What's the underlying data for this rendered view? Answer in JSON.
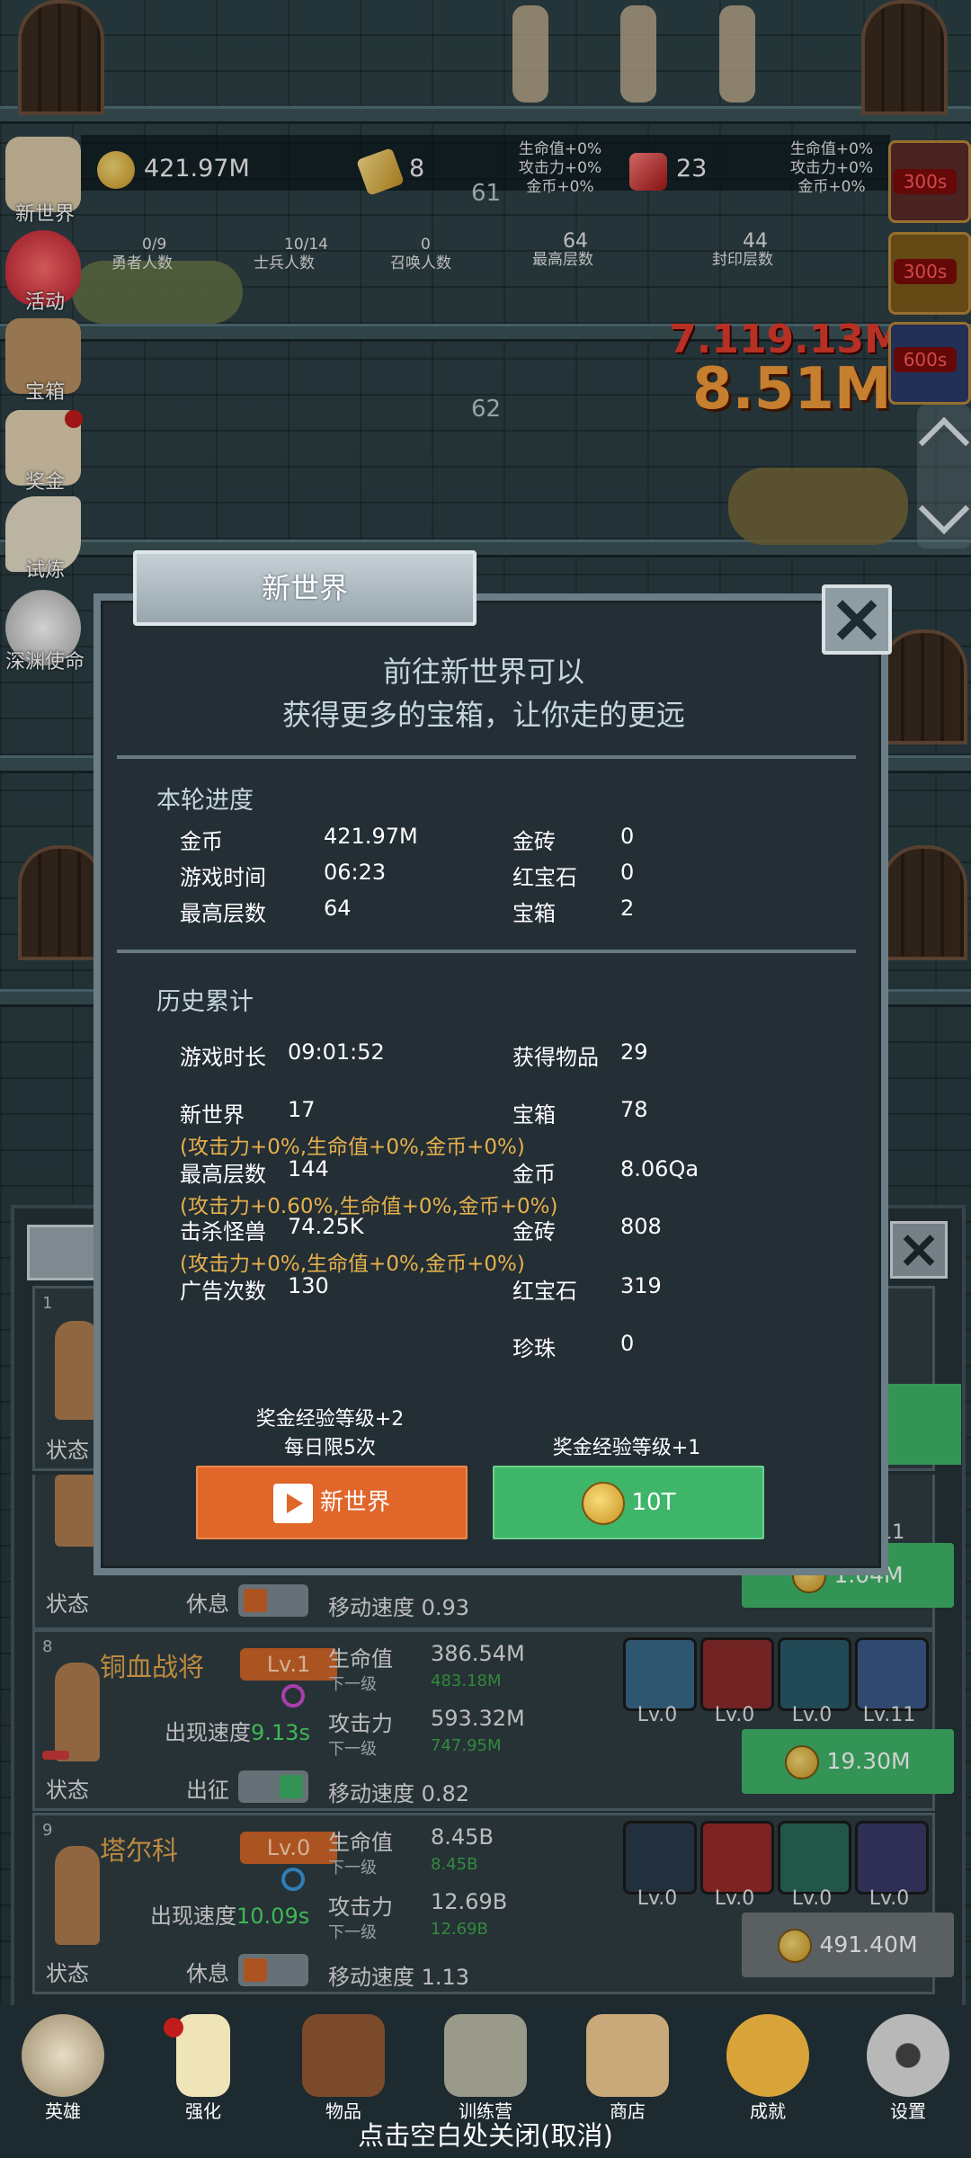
{
  "hud": {
    "gold": "421.97M",
    "gold_bar": "8",
    "ruby": "23",
    "bonus_left": [
      "生命值+0%",
      "攻击力+0%",
      "金币+0%"
    ],
    "bonus_right": [
      "生命值+0%",
      "攻击力+0%",
      "金币+0%"
    ],
    "floor_top": "61",
    "floor_mid": "62",
    "stats": [
      {
        "value": "0/9",
        "label": "勇者人数"
      },
      {
        "value": "10/14",
        "label": "士兵人数"
      },
      {
        "value": "0",
        "label": "召唤人数"
      },
      {
        "value": "64",
        "label": "最高层数"
      },
      {
        "value": "44",
        "label": "封印层数"
      }
    ],
    "damage_1": "7.119.13M",
    "damage_2": "8.51M",
    "timers": [
      "300s",
      "300s",
      "600s"
    ]
  },
  "side_menu": [
    {
      "label": "新世界",
      "icon": "scroll-icon"
    },
    {
      "label": "活动",
      "icon": "heart-icon"
    },
    {
      "label": "宝箱",
      "icon": "chest-icon"
    },
    {
      "label": "奖金",
      "icon": "envelope-icon"
    },
    {
      "label": "试炼",
      "icon": "horn-icon"
    },
    {
      "label": "深渊使命",
      "icon": "orb-icon"
    }
  ],
  "modal": {
    "title": "新世界",
    "intro_1": "前往新世界可以",
    "intro_2": "获得更多的宝箱，让你走的更远",
    "round_title": "本轮进度",
    "round": {
      "gold_label": "金币",
      "gold": "421.97M",
      "bar_label": "金砖",
      "bar": "0",
      "time_label": "游戏时间",
      "time": "06:23",
      "ruby_label": "红宝石",
      "ruby": "0",
      "floor_label": "最高层数",
      "floor": "64",
      "chest_label": "宝箱",
      "chest": "2"
    },
    "history_title": "历史累计",
    "history": {
      "playtime_label": "游戏时长",
      "playtime": "09:01:52",
      "items_label": "获得物品",
      "items": "29",
      "newworld_label": "新世界",
      "newworld": "17",
      "chest_label": "宝箱",
      "chest": "78",
      "bonus_1": "(攻击力+0%,生命值+0%,金币+0%)",
      "floor_label": "最高层数",
      "floor": "144",
      "gold_label": "金币",
      "gold": "8.06Qa",
      "bonus_2": "(攻击力+0.60%,生命值+0%,金币+0%)",
      "kills_label": "击杀怪兽",
      "kills": "74.25K",
      "bar_label": "金砖",
      "bar": "808",
      "bonus_3": "(攻击力+0%,生命值+0%,金币+0%)",
      "ads_label": "广告次数",
      "ads": "130",
      "ruby_label": "红宝石",
      "ruby": "319",
      "pearl_label": "珍珠",
      "pearl": "0"
    },
    "note_left_1": "奖金经验等级+2",
    "note_left_2": "每日限5次",
    "note_right": "奖金经验等级+1",
    "btn_video": "新世界",
    "btn_coin": "10T"
  },
  "hero_list": {
    "status_label": "状态",
    "rest_label": "休息",
    "deploy_label": "出征",
    "hp_label": "生命值",
    "next_label": "下一级",
    "atk_label": "攻击力",
    "move_label": "移动速度",
    "appear_label": "出现速度",
    "card1_index": "1",
    "partial_move": "0.93",
    "partial_price": "1.04M",
    "partial_skill_lv": "Lv.11",
    "heroes": [
      {
        "index": "8",
        "name": "铜血战将",
        "level": "Lv.1",
        "appear": "9.13s",
        "hp": "386.54M",
        "hp_next": "483.18M",
        "atk": "593.32M",
        "atk_next": "747.95M",
        "move": "0.82",
        "price": "19.30M",
        "skills": [
          "Lv.0",
          "Lv.0",
          "Lv.0",
          "Lv.11"
        ],
        "state": "出征"
      },
      {
        "index": "9",
        "name": "塔尔科",
        "level": "Lv.0",
        "appear": "10.09s",
        "hp": "8.45B",
        "hp_next": "8.45B",
        "atk": "12.69B",
        "atk_next": "12.69B",
        "move": "1.13",
        "price": "491.40M",
        "skills": [
          "Lv.0",
          "Lv.0",
          "Lv.0",
          "Lv.0"
        ],
        "state": "休息"
      }
    ]
  },
  "bottom_nav": [
    {
      "label": "英雄",
      "icon": "skull-icon"
    },
    {
      "label": "强化",
      "icon": "candle-icon"
    },
    {
      "label": "物品",
      "icon": "book-icon"
    },
    {
      "label": "训练营",
      "icon": "lantern-icon"
    },
    {
      "label": "商店",
      "icon": "mug-icon"
    },
    {
      "label": "成就",
      "icon": "key-icon"
    },
    {
      "label": "设置",
      "icon": "gear-icon"
    }
  ],
  "close_hint": "点击空白处关闭(取消)"
}
